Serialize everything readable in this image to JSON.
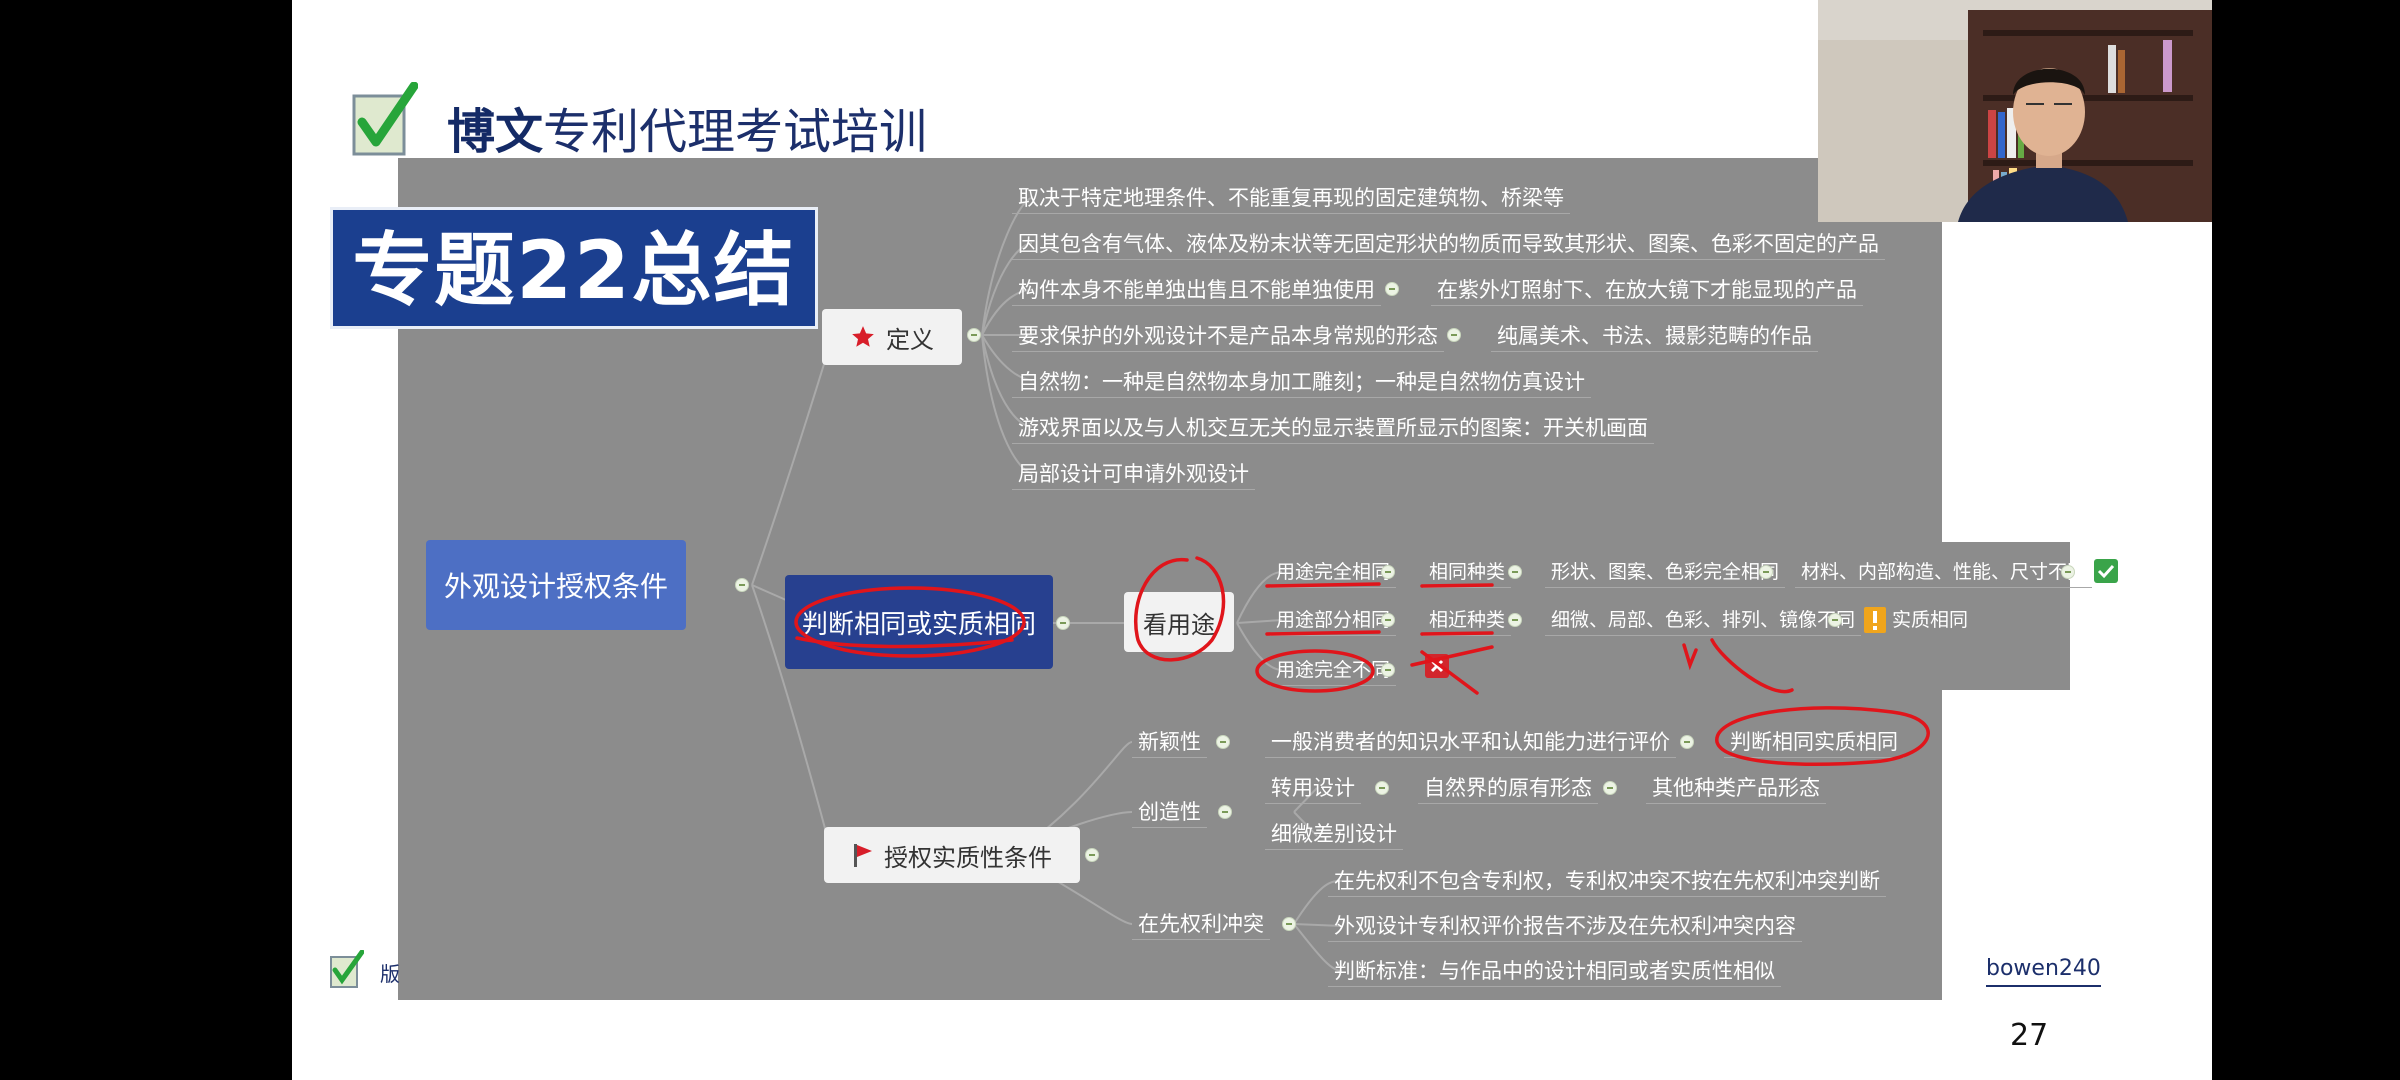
{
  "brand": {
    "name_bold": "博文",
    "name_rest": "专利代理考试培训"
  },
  "title_banner": "专题22总结",
  "mindmap": {
    "root": "外观设计授权条件",
    "definition": {
      "label": "定义",
      "items": [
        "取决于特定地理条件、不能重复再现的固定建筑物、桥梁等",
        "因其包含有气体、液体及粉末状等无固定形状的物质而导致其形状、图案、色彩不固定的产品",
        "构件本身不能单独出售且不能单独使用",
        "要求保护的外观设计不是产品本身常规的形态",
        "自然物：一种是自然物本身加工雕刻；一种是自然物仿真设计",
        "游戏界面以及与人机交互无关的显示装置所显示的图案：开关机画面",
        "局部设计可申请外观设计"
      ],
      "followups": [
        "在紫外灯照射下、在放大镜下才能显现的产品",
        "纯属美术、书法、摄影范畴的作品"
      ]
    },
    "judge": {
      "label": "判断相同或实质相同",
      "use": "看用途",
      "rows": [
        {
          "use": "用途完全相同",
          "kind": "相同种类",
          "detail": "形状、图案、色彩完全相同",
          "detail2": "材料、内部构造、性能、尺寸不同",
          "result": "相同"
        },
        {
          "use": "用途部分相同",
          "kind": "相近种类",
          "detail": "细微、局部、色彩、排列、镜像不同",
          "result": "实质相同"
        },
        {
          "use": "用途完全不同"
        }
      ]
    },
    "grant": {
      "label": "授权实质性条件",
      "novelty": {
        "label": "新颖性",
        "item": "一般消费者的知识水平和认知能力进行评价",
        "result": "判断相同实质相同"
      },
      "creativity": {
        "label": "创造性",
        "item1": "转用设计",
        "item1b": "自然界的原有形态",
        "item1c": "其他种类产品形态",
        "item2": "细微差别设计"
      },
      "prior": {
        "label": "在先权利冲突",
        "items": [
          "在先权利不包含专利权，专利权冲突不按在先权利冲突判断",
          "外观设计专利权评价报告不涉及在先权利冲突内容",
          "判断标准：与作品中的设计相同或者实质性相似"
        ]
      }
    }
  },
  "footer": {
    "label": "版",
    "wechat": "bowen240",
    "page": "27"
  },
  "colors": {
    "brand_navy": "#1c2f6b",
    "banner": "#1b3f8f",
    "mindmap_bg": "#8c8c8c",
    "annotation": "#e0151b"
  },
  "icons": [
    "check-logo-icon",
    "star-icon",
    "flag-icon",
    "checkmark-icon",
    "warning-icon",
    "cross-icon",
    "collapse-icon"
  ]
}
